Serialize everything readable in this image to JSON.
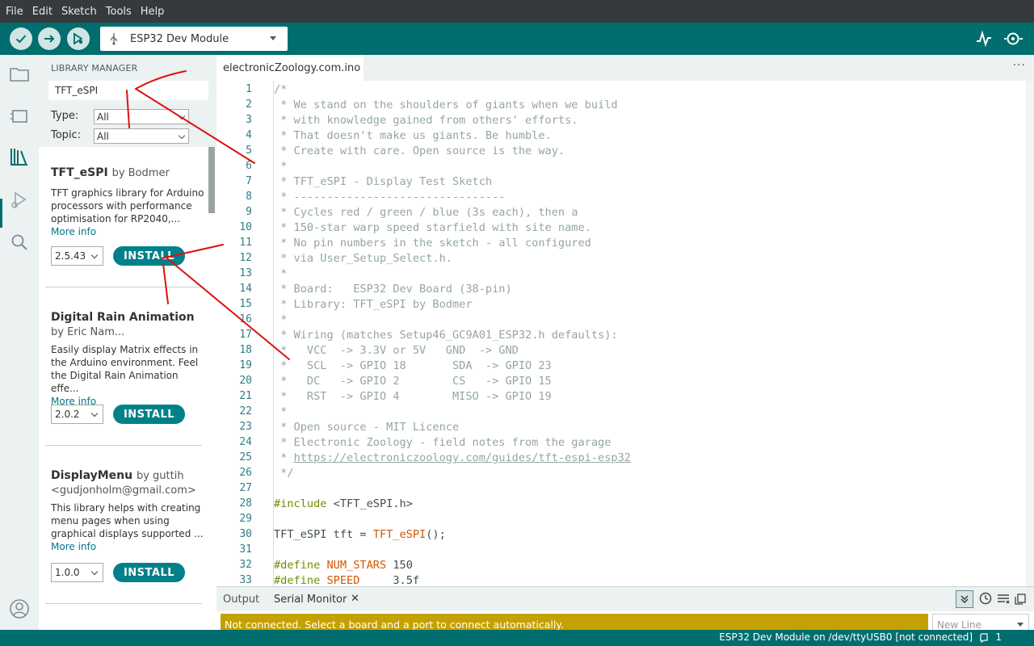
{
  "menu": [
    "File",
    "Edit",
    "Sketch",
    "Tools",
    "Help"
  ],
  "toolbar": {
    "board": "ESP32 Dev Module",
    "colors": {
      "accent": "#006e6e",
      "button_bg": "#d1e5e5"
    }
  },
  "library": {
    "title": "LIBRARY MANAGER",
    "search_value": "TFT_eSPI",
    "type_label": "Type:",
    "type_value": "All",
    "topic_label": "Topic:",
    "topic_value": "All",
    "items": [
      {
        "name": "TFT_eSPI",
        "by": "by Bodmer",
        "author": "",
        "description": "TFT graphics library for Arduino processors with performance optimisation for RP2040,...",
        "more": "More info",
        "version": "2.5.43",
        "install": "INSTALL"
      },
      {
        "name": "Digital Rain Animation",
        "by": "",
        "author": "by Eric Nam...",
        "description": "Easily display Matrix effects in the Arduino environment. Feel the Digital Rain Animation effe...",
        "more": "More info",
        "version": "2.0.2",
        "install": "INSTALL"
      },
      {
        "name": "DisplayMenu",
        "by": "by guttih",
        "author": "<gudjonholm@gmail.com>",
        "description": "This library helps with creating menu pages when using graphical displays supported ...",
        "more": "More info",
        "version": "1.0.0",
        "install": "INSTALL"
      }
    ]
  },
  "editor": {
    "tab": "electronicZoology.com.ino",
    "more": "···",
    "lines": [
      {
        "n": "1",
        "parts": [
          {
            "c": "cm",
            "t": "/*"
          }
        ]
      },
      {
        "n": "2",
        "parts": [
          {
            "c": "cm",
            "t": " * We stand on the shoulders of giants when we build"
          }
        ]
      },
      {
        "n": "3",
        "parts": [
          {
            "c": "cm",
            "t": " * with knowledge gained from others' efforts."
          }
        ]
      },
      {
        "n": "4",
        "parts": [
          {
            "c": "cm",
            "t": " * That doesn't make us giants. Be humble."
          }
        ]
      },
      {
        "n": "5",
        "parts": [
          {
            "c": "cm",
            "t": " * Create with care. Open source is the way."
          }
        ]
      },
      {
        "n": "6",
        "parts": [
          {
            "c": "cm",
            "t": " *"
          }
        ]
      },
      {
        "n": "7",
        "parts": [
          {
            "c": "cm",
            "t": " * TFT_eSPI - Display Test Sketch"
          }
        ]
      },
      {
        "n": "8",
        "parts": [
          {
            "c": "cm",
            "t": " * --------------------------------"
          }
        ]
      },
      {
        "n": "9",
        "parts": [
          {
            "c": "cm",
            "t": " * Cycles red / green / blue (3s each), then a"
          }
        ]
      },
      {
        "n": "10",
        "parts": [
          {
            "c": "cm",
            "t": " * 150-star warp speed starfield with site name."
          }
        ]
      },
      {
        "n": "11",
        "parts": [
          {
            "c": "cm",
            "t": " * No pin numbers in the sketch - all configured"
          }
        ]
      },
      {
        "n": "12",
        "parts": [
          {
            "c": "cm",
            "t": " * via User_Setup_Select.h."
          }
        ]
      },
      {
        "n": "13",
        "parts": [
          {
            "c": "cm",
            "t": " *"
          }
        ]
      },
      {
        "n": "14",
        "parts": [
          {
            "c": "cm",
            "t": " * Board:   ESP32 Dev Board (38-pin)"
          }
        ]
      },
      {
        "n": "15",
        "parts": [
          {
            "c": "cm",
            "t": " * Library: TFT_eSPI by Bodmer"
          }
        ]
      },
      {
        "n": "16",
        "parts": [
          {
            "c": "cm",
            "t": " *"
          }
        ]
      },
      {
        "n": "17",
        "parts": [
          {
            "c": "cm",
            "t": " * Wiring (matches Setup46_GC9A01_ESP32.h defaults):"
          }
        ]
      },
      {
        "n": "18",
        "parts": [
          {
            "c": "cm",
            "t": " *   VCC  -> 3.3V or 5V   GND  -> GND"
          }
        ]
      },
      {
        "n": "19",
        "parts": [
          {
            "c": "cm",
            "t": " *   SCL  -> GPIO 18       SDA  -> GPIO 23"
          }
        ]
      },
      {
        "n": "20",
        "parts": [
          {
            "c": "cm",
            "t": " *   DC   -> GPIO 2        CS   -> GPIO 15"
          }
        ]
      },
      {
        "n": "21",
        "parts": [
          {
            "c": "cm",
            "t": " *   RST  -> GPIO 4        MISO -> GPIO 19"
          }
        ]
      },
      {
        "n": "22",
        "parts": [
          {
            "c": "cm",
            "t": " *"
          }
        ]
      },
      {
        "n": "23",
        "parts": [
          {
            "c": "cm",
            "t": " * Open source - MIT Licence"
          }
        ]
      },
      {
        "n": "24",
        "parts": [
          {
            "c": "cm",
            "t": " * Electronic Zoology - field notes from the garage"
          }
        ]
      },
      {
        "n": "25",
        "parts": [
          {
            "c": "cm",
            "t": " * "
          },
          {
            "c": "cm lnk",
            "t": "https://electroniczoology.com/guides/tft-espi-esp32"
          }
        ]
      },
      {
        "n": "26",
        "parts": [
          {
            "c": "cm",
            "t": " */"
          }
        ]
      },
      {
        "n": "27",
        "parts": []
      },
      {
        "n": "28",
        "parts": [
          {
            "c": "pp",
            "t": "#include"
          },
          {
            "c": "",
            "t": " <TFT_eSPI.h>"
          }
        ]
      },
      {
        "n": "29",
        "parts": []
      },
      {
        "n": "30",
        "parts": [
          {
            "c": "",
            "t": "TFT_eSPI tft = "
          },
          {
            "c": "kw",
            "t": "TFT_eSPI"
          },
          {
            "c": "",
            "t": "();"
          }
        ]
      },
      {
        "n": "31",
        "parts": []
      },
      {
        "n": "32",
        "parts": [
          {
            "c": "pp",
            "t": "#define"
          },
          {
            "c": "",
            "t": " "
          },
          {
            "c": "kw",
            "t": "NUM_STARS"
          },
          {
            "c": "",
            "t": " 150"
          }
        ]
      },
      {
        "n": "33",
        "parts": [
          {
            "c": "pp",
            "t": "#define"
          },
          {
            "c": "",
            "t": " "
          },
          {
            "c": "kw",
            "t": "SPEED"
          },
          {
            "c": "",
            "t": "     3.5f"
          }
        ]
      }
    ]
  },
  "bottom": {
    "tab_output": "Output",
    "tab_serial": "Serial Monitor",
    "close": "✕",
    "warning": "Not connected. Select a board and a port to connect automatically.",
    "newline": "New Line"
  },
  "status": {
    "text": "ESP32 Dev Module on /dev/ttyUSB0 [not connected]",
    "notifications": "1"
  }
}
